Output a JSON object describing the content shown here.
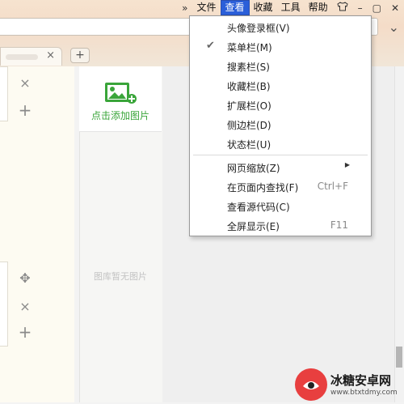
{
  "menubar": {
    "more_symbol": "»",
    "items": [
      "文件",
      "查看",
      "收藏",
      "工具",
      "帮助"
    ],
    "active_index": 1,
    "window_controls": [
      "–",
      "▢",
      "✕"
    ]
  },
  "left_panel": {
    "close_symbol": "×",
    "add_symbol": "+",
    "move_symbol": "✥"
  },
  "image_panel": {
    "add_label": "点击添加图片",
    "empty_label": "图库暂无图片"
  },
  "tabbar": {
    "close_symbol": "×",
    "new_tab_symbol": "+"
  },
  "view_menu": {
    "items": [
      {
        "label": "头像登录框(V)",
        "checked": false,
        "shortcut": ""
      },
      {
        "label": "菜单栏(M)",
        "checked": true,
        "shortcut": ""
      },
      {
        "label": "搜素栏(S)",
        "checked": false,
        "shortcut": ""
      },
      {
        "label": "收藏栏(B)",
        "checked": false,
        "shortcut": ""
      },
      {
        "label": "扩展栏(O)",
        "checked": false,
        "shortcut": ""
      },
      {
        "label": "侧边栏(D)",
        "checked": false,
        "shortcut": ""
      },
      {
        "label": "状态栏(U)",
        "checked": false,
        "shortcut": ""
      },
      {
        "label": "网页缩放(Z)",
        "checked": false,
        "shortcut": "",
        "submenu": true
      },
      {
        "label": "在页面内查找(F)",
        "checked": false,
        "shortcut": "Ctrl+F"
      },
      {
        "label": "查看源代码(C)",
        "checked": false,
        "shortcut": ""
      },
      {
        "label": "全屏显示(E)",
        "checked": false,
        "shortcut": "F11"
      }
    ],
    "check_symbol": "✔",
    "submenu_symbol": "▶"
  },
  "watermark": {
    "title": "冰糖安卓网",
    "url": "www.btxtdmy.com"
  },
  "colors": {
    "menu_active": "#2b5fd9",
    "add_image_green": "#3aa53a",
    "watermark_red": "#e83f3f"
  }
}
